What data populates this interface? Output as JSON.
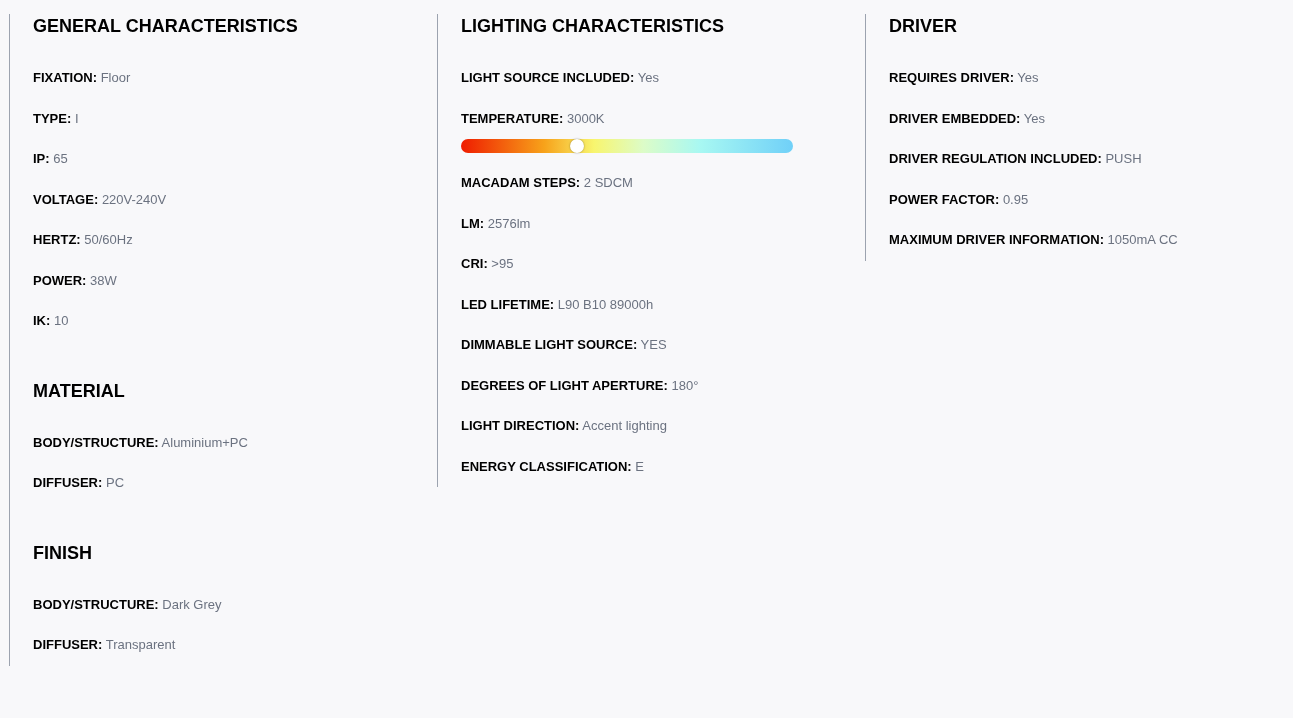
{
  "columns": [
    {
      "sections": [
        {
          "title": "GENERAL CHARACTERISTICS",
          "rows": [
            {
              "kind": "text",
              "label": "FIXATION:",
              "value": "Floor"
            },
            {
              "kind": "text",
              "label": "TYPE:",
              "value": "I"
            },
            {
              "kind": "text",
              "label": "IP:",
              "value": "65"
            },
            {
              "kind": "text",
              "label": "VOLTAGE:",
              "value": "220V-240V"
            },
            {
              "kind": "text",
              "label": "HERTZ:",
              "value": "50/60Hz"
            },
            {
              "kind": "text",
              "label": "POWER:",
              "value": "38W"
            },
            {
              "kind": "text",
              "label": "IK:",
              "value": "10"
            }
          ]
        },
        {
          "title": "MATERIAL",
          "rows": [
            {
              "kind": "text",
              "label": "BODY/STRUCTURE:",
              "value": "Aluminium+PC"
            },
            {
              "kind": "text",
              "label": "DIFFUSER:",
              "value": "PC"
            }
          ]
        },
        {
          "title": "FINISH",
          "rows": [
            {
              "kind": "text",
              "label": "BODY/STRUCTURE:",
              "value": "Dark Grey"
            },
            {
              "kind": "text",
              "label": "DIFFUSER:",
              "value": "Transparent"
            }
          ]
        }
      ]
    },
    {
      "sections": [
        {
          "title": "LIGHTING CHARACTERISTICS",
          "rows": [
            {
              "kind": "text",
              "label": "LIGHT SOURCE INCLUDED:",
              "value": "Yes"
            },
            {
              "kind": "scale",
              "label": "TEMPERATURE:",
              "value": "3000K",
              "level": 0.35
            },
            {
              "kind": "text",
              "label": "MACADAM STEPS:",
              "value": "2 SDCM"
            },
            {
              "kind": "text",
              "label": "LM:",
              "value": "2576lm"
            },
            {
              "kind": "text",
              "label": "CRI:",
              "value": ">95"
            },
            {
              "kind": "text",
              "label": "LED LIFETIME:",
              "value": "L90 B10 89000h"
            },
            {
              "kind": "text",
              "label": "DIMMABLE LIGHT SOURCE:",
              "value": "YES"
            },
            {
              "kind": "text",
              "label": "DEGREES OF LIGHT APERTURE:",
              "value": "180°"
            },
            {
              "kind": "text",
              "label": "LIGHT DIRECTION:",
              "value": "Accent lighting"
            },
            {
              "kind": "text",
              "label": "ENERGY CLASSIFICATION:",
              "value": "E"
            }
          ]
        }
      ]
    },
    {
      "sections": [
        {
          "title": "DRIVER",
          "rows": [
            {
              "kind": "text",
              "label": "REQUIRES DRIVER:",
              "value": "Yes"
            },
            {
              "kind": "text",
              "label": "DRIVER EMBEDDED:",
              "value": "Yes"
            },
            {
              "kind": "text",
              "label": "DRIVER REGULATION INCLUDED:",
              "value": "PUSH"
            },
            {
              "kind": "text",
              "label": "POWER FACTOR:",
              "value": "0.95"
            },
            {
              "kind": "text",
              "label": "MAXIMUM DRIVER INFORMATION:",
              "value": "1050mA CC"
            }
          ]
        }
      ]
    }
  ]
}
